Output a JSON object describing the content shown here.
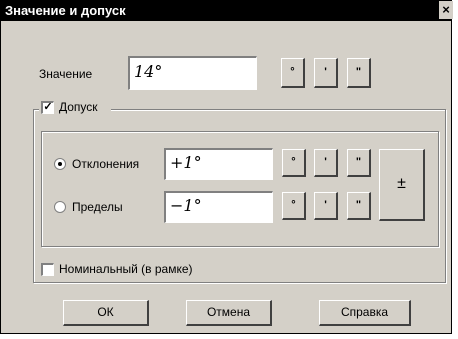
{
  "window": {
    "title": "Значение и допуск",
    "close_symbol": "×"
  },
  "value": {
    "label": "Значение",
    "field_value": "14°"
  },
  "unit_buttons": {
    "degree": "°",
    "minute": "'",
    "second": "\""
  },
  "tolerance": {
    "checkbox_label": "Допуск",
    "checked": true,
    "deviation_label": "Отклонения",
    "deviation_value": "+1°",
    "limits_label": "Пределы",
    "limits_value": "−1°",
    "plusminus_label": "±"
  },
  "nominal": {
    "label": "Номинальный (в рамке)",
    "checked": false
  },
  "footer": {
    "ok_label": "ОК",
    "cancel_label": "Отмена",
    "help_label": "Справка"
  }
}
